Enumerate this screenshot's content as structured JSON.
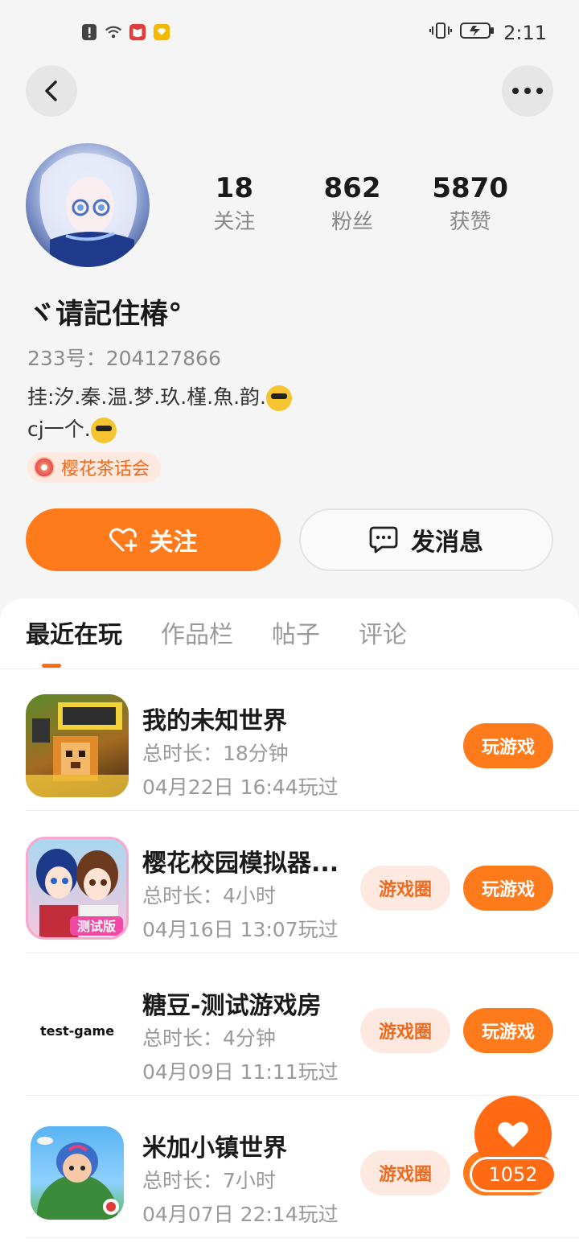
{
  "status_bar": {
    "time": "2:11",
    "icons": [
      "alert-icon",
      "wifi-icon",
      "book-app-icon",
      "notification-app-icon",
      "vibrate-icon",
      "battery-charging-icon"
    ]
  },
  "header": {
    "back_icon": "chevron-left-icon",
    "more_icon": "more-dots-icon"
  },
  "profile": {
    "nickname": "ヾ请記住椿°",
    "uid_label": "233号：",
    "uid_value": "204127866",
    "bio_line1": "挂:汐.秦.温.梦.玖.槿.魚.韵.",
    "bio_line2": "cj一个.",
    "club_tag": "樱花茶话会",
    "stats": [
      {
        "value": "18",
        "label": "关注"
      },
      {
        "value": "862",
        "label": "粉丝"
      },
      {
        "value": "5870",
        "label": "获赞"
      }
    ]
  },
  "actions": {
    "follow_label": "关注",
    "message_label": "发消息"
  },
  "tabs": [
    {
      "label": "最近在玩",
      "active": true
    },
    {
      "label": "作品栏",
      "active": false
    },
    {
      "label": "帖子",
      "active": false
    },
    {
      "label": "评论",
      "active": false
    }
  ],
  "games": [
    {
      "name": "我的未知世界",
      "duration": "总时长：18分钟",
      "last_played": "04月22日 16:44玩过",
      "has_circle": false,
      "play_label": "玩游戏",
      "icon_text": ""
    },
    {
      "name": "樱花校园模拟器...",
      "duration": "总时长：4小时",
      "last_played": "04月16日 13:07玩过",
      "has_circle": true,
      "circle_label": "游戏圈",
      "play_label": "玩游戏",
      "icon_text": "测试版"
    },
    {
      "name": "糖豆-测试游戏房",
      "duration": "总时长：4分钟",
      "last_played": "04月09日 11:11玩过",
      "has_circle": true,
      "circle_label": "游戏圈",
      "play_label": "玩游戏",
      "icon_text": "test-game"
    },
    {
      "name": "米加小镇世界",
      "duration": "总时长：7小时",
      "last_played": "04月07日 22:14玩过",
      "has_circle": true,
      "circle_label": "游戏圈",
      "play_label": "玩游戏",
      "icon_text": ""
    }
  ],
  "floating_like": {
    "count": "1052"
  },
  "colors": {
    "accent": "#ff7a1a",
    "accent_soft": "#fde9df",
    "text_primary": "#1a1a1a",
    "text_secondary": "#9a9a9a"
  }
}
